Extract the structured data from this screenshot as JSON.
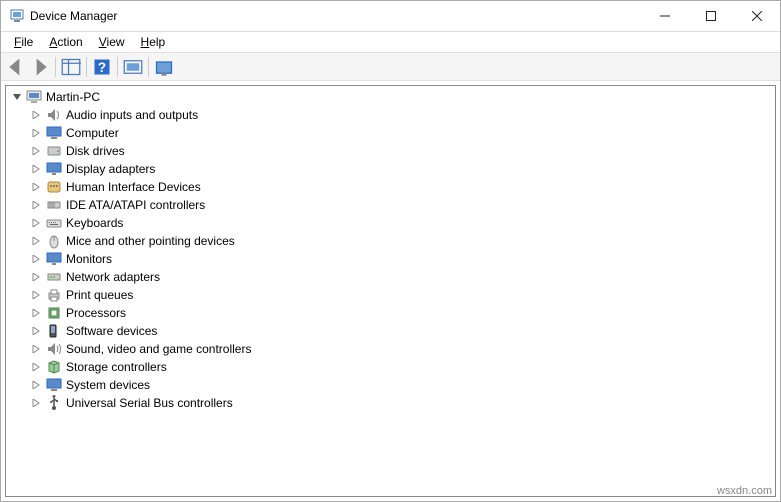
{
  "window": {
    "title": "Device Manager"
  },
  "menu": {
    "file": "File",
    "action": "Action",
    "view": "View",
    "help": "Help"
  },
  "tree": {
    "root": "Martin-PC",
    "items": [
      {
        "label": "Audio inputs and outputs",
        "icon": "audio"
      },
      {
        "label": "Computer",
        "icon": "computer"
      },
      {
        "label": "Disk drives",
        "icon": "disk"
      },
      {
        "label": "Display adapters",
        "icon": "display"
      },
      {
        "label": "Human Interface Devices",
        "icon": "hid"
      },
      {
        "label": "IDE ATA/ATAPI controllers",
        "icon": "ide"
      },
      {
        "label": "Keyboards",
        "icon": "keyboard"
      },
      {
        "label": "Mice and other pointing devices",
        "icon": "mouse"
      },
      {
        "label": "Monitors",
        "icon": "monitor"
      },
      {
        "label": "Network adapters",
        "icon": "network"
      },
      {
        "label": "Print queues",
        "icon": "printer"
      },
      {
        "label": "Processors",
        "icon": "processor"
      },
      {
        "label": "Software devices",
        "icon": "software"
      },
      {
        "label": "Sound, video and game controllers",
        "icon": "sound"
      },
      {
        "label": "Storage controllers",
        "icon": "storage"
      },
      {
        "label": "System devices",
        "icon": "system"
      },
      {
        "label": "Universal Serial Bus controllers",
        "icon": "usb"
      }
    ]
  },
  "watermark": "wsxdn.com"
}
